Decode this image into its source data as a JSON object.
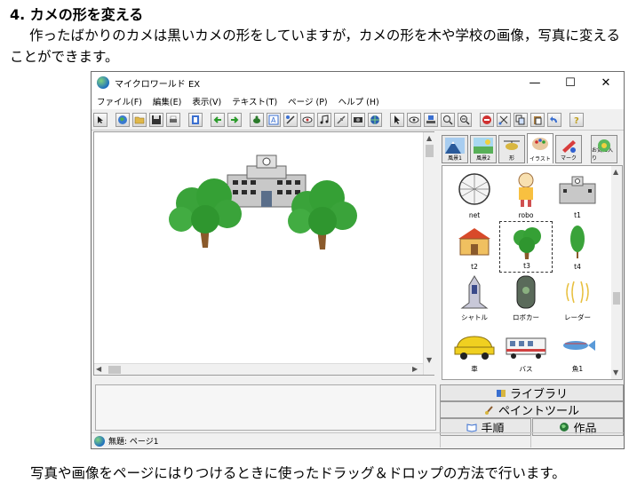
{
  "doc": {
    "heading": "4. カメの形を変える",
    "intro": "作ったばかりのカメは黒いカメの形をしていますが，カメの形を木や学校の画像，写真に変えることができます。",
    "outro": "写真や画像をページにはりつけるときに使ったドラッグ＆ドロップの方法で行います。"
  },
  "window": {
    "title": "マイクロワールド EX",
    "controls": [
      "—",
      "☐",
      "✕"
    ]
  },
  "menu": [
    "ファイル(F)",
    "編集(E)",
    "表示(V)",
    "テキスト(T)",
    "ページ (P)",
    "ヘルプ (H)"
  ],
  "categories": [
    {
      "label": "風景1",
      "color": "#4a8fd8"
    },
    {
      "label": "風景2",
      "color": "#58b058"
    },
    {
      "label": "形",
      "color": "#d8b640"
    },
    {
      "label": "イラスト",
      "color": "#c86a3c"
    },
    {
      "label": "マーク",
      "color": "#d83c3c"
    },
    {
      "label": "お気に入り",
      "color": "#5bb85b"
    }
  ],
  "library": {
    "items": [
      {
        "label": "net"
      },
      {
        "label": "robo"
      },
      {
        "label": "t1"
      },
      {
        "label": "t2"
      },
      {
        "label": "t3"
      },
      {
        "label": "t4"
      },
      {
        "label": "シャトル"
      },
      {
        "label": "ロボカー"
      },
      {
        "label": "レーダー"
      },
      {
        "label": "車"
      },
      {
        "label": "バス"
      },
      {
        "label": "魚1"
      }
    ]
  },
  "panel_buttons": {
    "library": "ライブラリ",
    "paint": "ペイントツール",
    "steps": "手順",
    "work": "作品"
  },
  "status": {
    "text": "無題: ページ1"
  },
  "colors": {
    "tree_green": "#3aa33a",
    "trunk": "#8a5a2b",
    "school": "#bfbfbf"
  }
}
